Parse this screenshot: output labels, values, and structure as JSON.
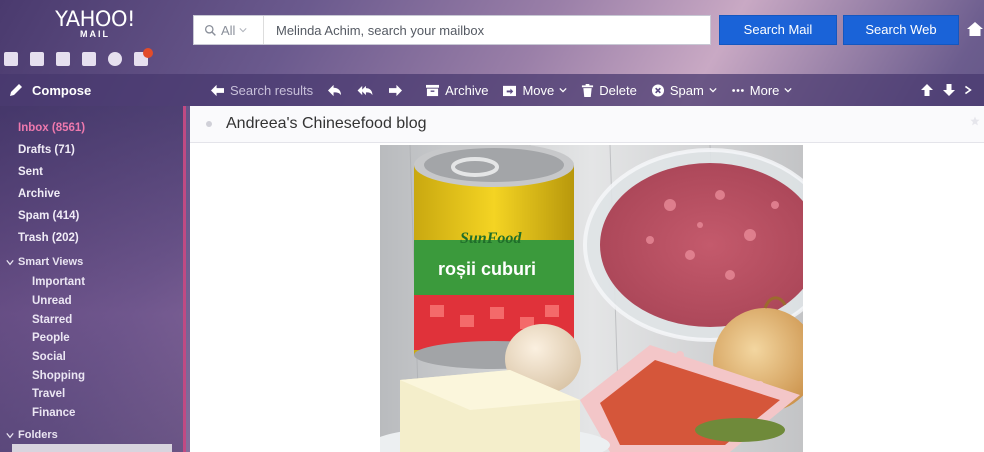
{
  "header": {
    "logo_big": "YAHOO!",
    "logo_small": "MAIL",
    "search": {
      "scope": "All",
      "placeholder": "Melinda Achim, search your mailbox"
    },
    "search_mail_label": "Search Mail",
    "search_web_label": "Search Web"
  },
  "toolbar": {
    "compose_label": "Compose",
    "search_results_label": "Search results",
    "archive_label": "Archive",
    "move_label": "Move",
    "delete_label": "Delete",
    "spam_label": "Spam",
    "more_label": "More"
  },
  "sidebar": {
    "folders": [
      {
        "label": "Inbox (8561)"
      },
      {
        "label": "Drafts (71)"
      },
      {
        "label": "Sent"
      },
      {
        "label": "Archive"
      },
      {
        "label": "Spam (414)"
      },
      {
        "label": "Trash (202)"
      }
    ],
    "smart_views_label": "Smart Views",
    "smart_views": [
      {
        "label": "Important"
      },
      {
        "label": "Unread"
      },
      {
        "label": "Starred"
      },
      {
        "label": "People"
      },
      {
        "label": "Social"
      },
      {
        "label": "Shopping"
      },
      {
        "label": "Travel"
      },
      {
        "label": "Finance"
      }
    ],
    "folders_label": "Folders"
  },
  "message": {
    "subject": "Andreea's Chinesefood blog",
    "can_brand": "SunFood",
    "can_text": "roșii cuburi"
  },
  "colors": {
    "accent_blue": "#1a63d8",
    "active_folder": "#ef79ae",
    "sidebar_edge": "#c04a83"
  }
}
